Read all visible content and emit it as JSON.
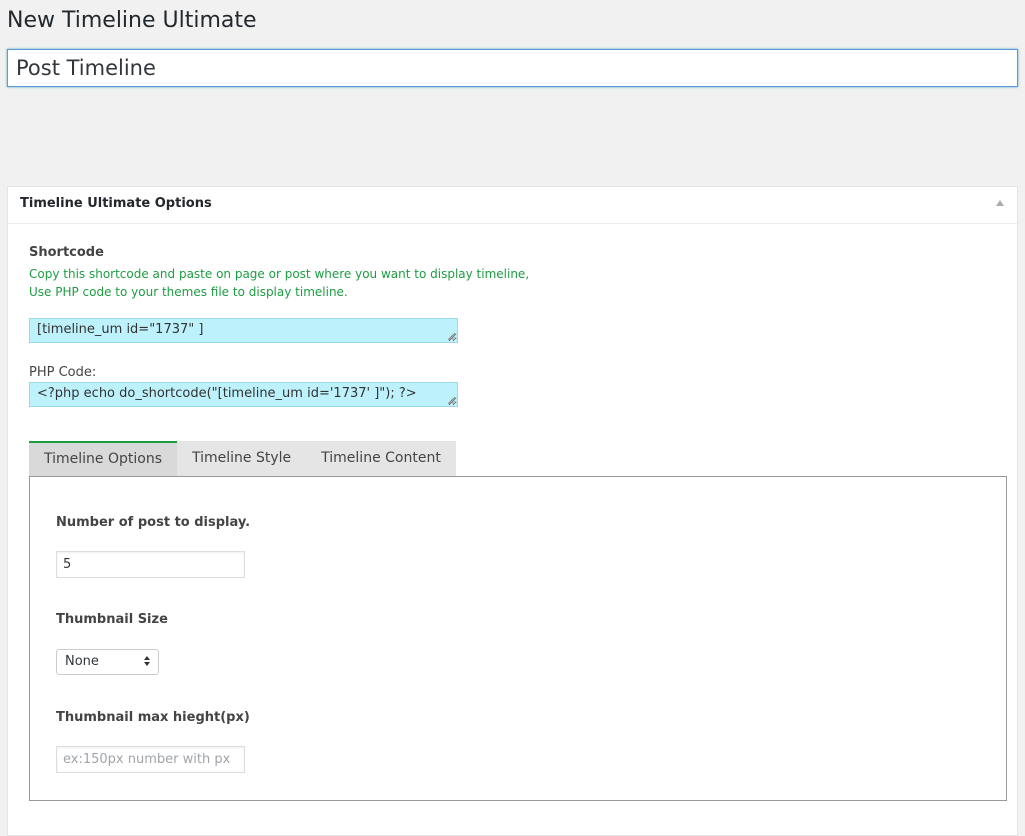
{
  "page": {
    "title": "New Timeline Ultimate",
    "post_title_value": "Post Timeline"
  },
  "metabox": {
    "title": "Timeline Ultimate Options",
    "shortcode": {
      "label": "Shortcode",
      "help_line1": "Copy this shortcode and paste on page or post where you want to display timeline,",
      "help_line2": "Use PHP code to your themes file to display timeline.",
      "value": "[timeline_um  id=\"1737\" ]"
    },
    "php_code": {
      "label": "PHP Code:",
      "value": "<?php echo do_shortcode(\"[timeline_um id='1737' ]\"); ?>"
    },
    "tabs": [
      {
        "label": "Timeline Options",
        "active": true
      },
      {
        "label": "Timeline Style",
        "active": false
      },
      {
        "label": "Timeline Content",
        "active": false
      }
    ],
    "options": {
      "num_posts_label": "Number of post to display.",
      "num_posts_value": "5",
      "thumb_size_label": "Thumbnail Size",
      "thumb_size_selected": "None",
      "thumb_max_height_label": "Thumbnail max hieght(px)",
      "thumb_max_height_placeholder": "ex:150px number with px"
    }
  },
  "colors": {
    "accent_green": "#1d9d43",
    "code_bg": "#bdf1fb",
    "focus_blue": "#5b9dd9"
  }
}
